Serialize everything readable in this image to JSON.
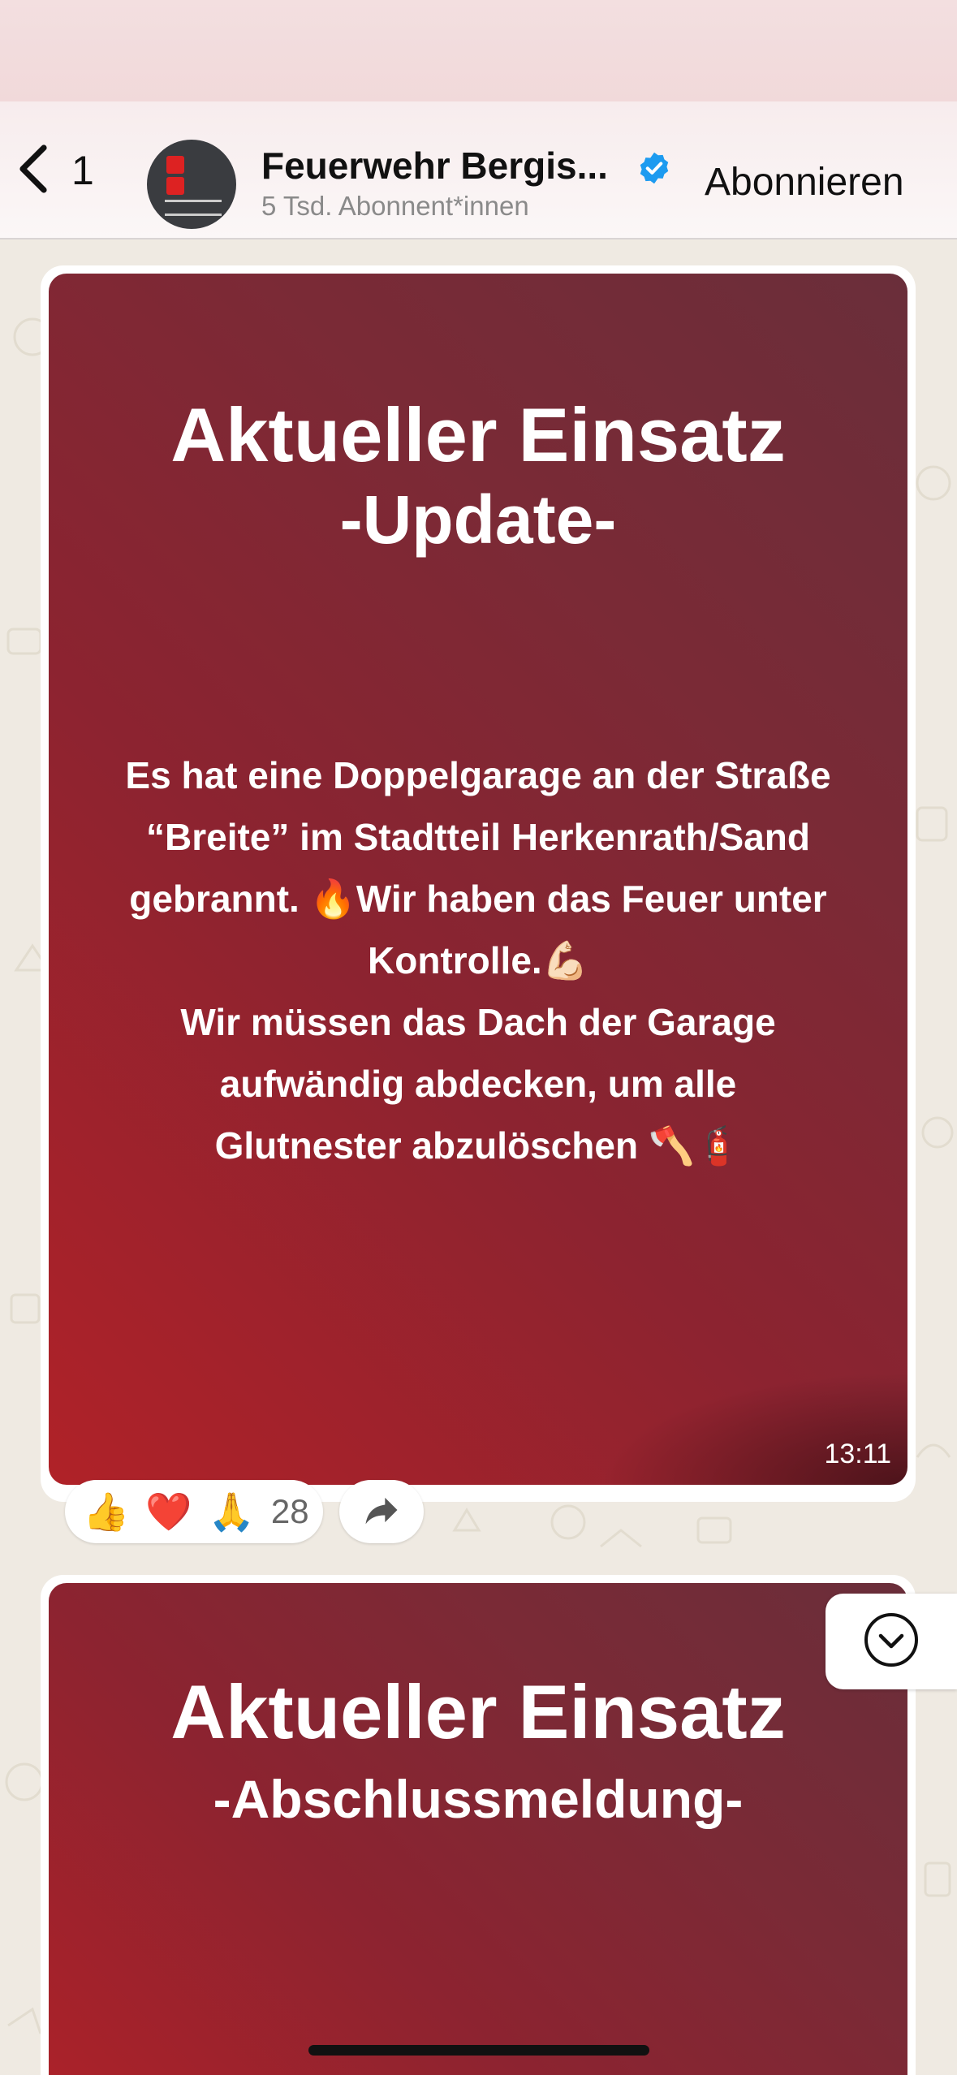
{
  "header": {
    "back_count": "1",
    "channel_name": "Feuerwehr Bergis...",
    "subscribers": "5 Tsd. Abonnent*innen",
    "subscribe_label": "Abonnieren",
    "verified_color": "#1d9bf0"
  },
  "messages": [
    {
      "title": "Aktueller Einsatz",
      "subtitle": "-Update-",
      "body_lines": [
        "Es hat eine Doppelgarage an der Straße",
        "“Breite” im Stadtteil Herkenrath/Sand",
        "gebrannt. 🔥Wir haben das Feuer unter",
        "Kontrolle.💪🏻",
        "Wir müssen das Dach der Garage",
        "aufwändig abdecken,  um alle",
        "Glutnester abzulöschen 🪓🧯"
      ],
      "time": "13:11",
      "reactions": {
        "emojis": [
          "👍",
          "❤️",
          "🙏"
        ],
        "count": "28"
      }
    },
    {
      "title": "Aktueller Einsatz",
      "subtitle": "-Abschlussmeldung-"
    }
  ],
  "colors": {
    "card_red": "#a02329",
    "card_wine": "#6a2e3a",
    "chat_bg": "#efeae2"
  },
  "icons": {
    "back": "chevron-left-icon",
    "verified": "verified-badge-icon",
    "forward": "forward-arrow-icon",
    "scroll": "chevron-down-circle-icon"
  }
}
